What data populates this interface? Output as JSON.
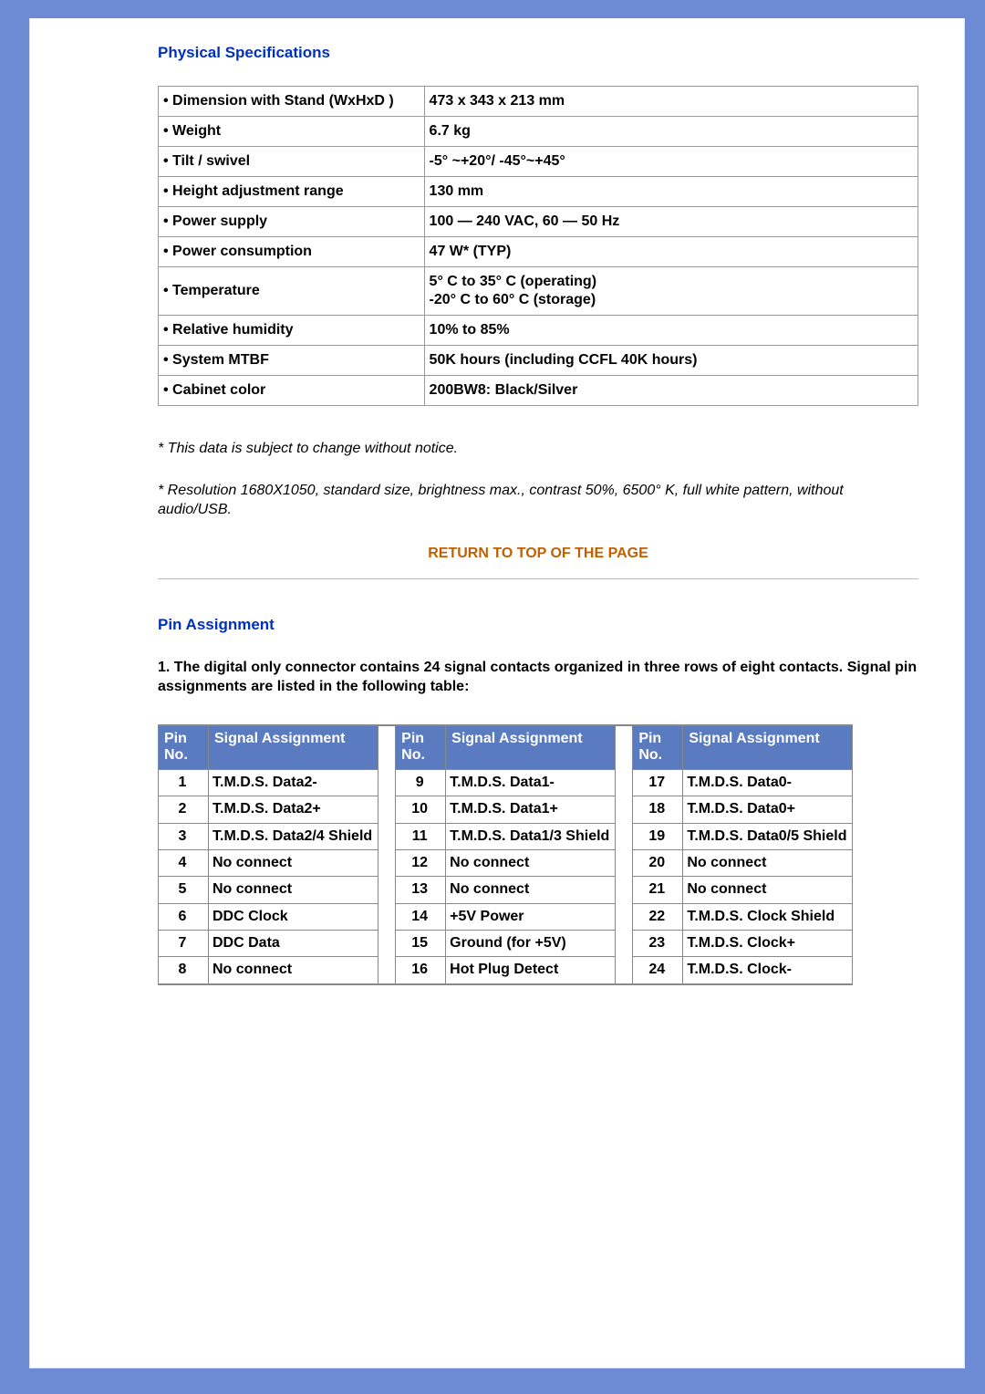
{
  "sections": {
    "physical": {
      "title": "Physical Specifications",
      "rows": [
        {
          "label": "• Dimension with Stand (WxHxD )",
          "value": "473 x 343 x 213 mm"
        },
        {
          "label": "• Weight",
          "value": "6.7 kg"
        },
        {
          "label": "• Tilt / swivel",
          "value": "-5° ~+20°/ -45°~+45°"
        },
        {
          "label": "• Height adjustment range",
          "value": "130 mm"
        },
        {
          "label": "• Power supply",
          "value": "100 — 240 VAC, 60 — 50 Hz"
        },
        {
          "label": "• Power consumption",
          "value": "47 W* (TYP)"
        },
        {
          "label": "• Temperature",
          "value": "5° C to 35° C (operating)\n-20° C to 60° C (storage)"
        },
        {
          "label": "• Relative humidity",
          "value": "10% to 85%"
        },
        {
          "label": "• System MTBF",
          "value": "50K hours (including CCFL 40K hours)"
        },
        {
          "label": "• Cabinet color",
          "value": "200BW8: Black/Silver"
        }
      ],
      "note1": "* This data is subject to change without notice.",
      "note2": "* Resolution 1680X1050, standard size, brightness max., contrast 50%, 6500° K, full white pattern, without audio/USB."
    },
    "return_link": "RETURN TO TOP OF THE PAGE",
    "pin": {
      "title": "Pin Assignment",
      "intro": "1. The digital only connector contains 24 signal contacts organized in three rows of eight contacts. Signal pin assignments are listed in the following table:",
      "headers": {
        "pin": "Pin No.",
        "signal": "Signal Assignment"
      },
      "group1": [
        {
          "no": "1",
          "sig": "T.M.D.S. Data2-"
        },
        {
          "no": "2",
          "sig": "T.M.D.S. Data2+"
        },
        {
          "no": "3",
          "sig": "T.M.D.S. Data2/4 Shield"
        },
        {
          "no": "4",
          "sig": "No connect"
        },
        {
          "no": "5",
          "sig": "No connect"
        },
        {
          "no": "6",
          "sig": "DDC Clock"
        },
        {
          "no": "7",
          "sig": "DDC Data"
        },
        {
          "no": "8",
          "sig": "No connect"
        }
      ],
      "group2": [
        {
          "no": "9",
          "sig": "T.M.D.S. Data1-"
        },
        {
          "no": "10",
          "sig": "T.M.D.S. Data1+"
        },
        {
          "no": "11",
          "sig": "T.M.D.S. Data1/3 Shield"
        },
        {
          "no": "12",
          "sig": "No connect"
        },
        {
          "no": "13",
          "sig": "No connect"
        },
        {
          "no": "14",
          "sig": "+5V Power"
        },
        {
          "no": "15",
          "sig": "Ground (for +5V)"
        },
        {
          "no": "16",
          "sig": "Hot Plug Detect"
        }
      ],
      "group3": [
        {
          "no": "17",
          "sig": "T.M.D.S. Data0-"
        },
        {
          "no": "18",
          "sig": "T.M.D.S. Data0+"
        },
        {
          "no": "19",
          "sig": "T.M.D.S. Data0/5 Shield"
        },
        {
          "no": "20",
          "sig": "No connect"
        },
        {
          "no": "21",
          "sig": "No connect"
        },
        {
          "no": "22",
          "sig": "T.M.D.S. Clock Shield"
        },
        {
          "no": "23",
          "sig": "T.M.D.S. Clock+"
        },
        {
          "no": "24",
          "sig": "T.M.D.S. Clock-"
        }
      ]
    }
  }
}
